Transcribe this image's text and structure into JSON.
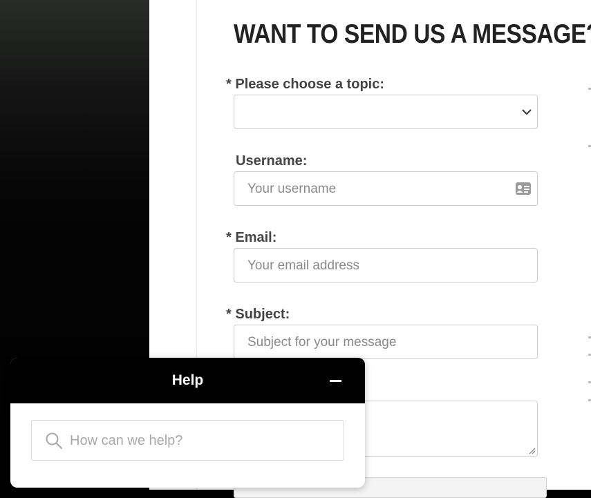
{
  "form": {
    "title": "WANT TO SEND US A MESSAGE?",
    "topic": {
      "required_mark": "*",
      "label": "Please choose a topic:",
      "value": ""
    },
    "username": {
      "label": "Username:",
      "placeholder": "Your username"
    },
    "email": {
      "required_mark": "*",
      "label": "Email:",
      "placeholder": "Your email address"
    },
    "subject": {
      "required_mark": "*",
      "label": "Subject:",
      "placeholder": "Subject for your message"
    },
    "message": {
      "placeholder": ""
    }
  },
  "help_widget": {
    "title": "Help",
    "search_placeholder": "How can we help?"
  },
  "icons": {
    "topic_dropdown": "chevron-down-icon",
    "username_field": "contact-card-icon",
    "minimize": "minimize-icon",
    "help_search": "search-icon"
  },
  "colors": {
    "header_bg": "#000000",
    "title_text": "#222222",
    "label_text": "#444444",
    "placeholder": "#8a8a8a",
    "field_border": "#cccccc"
  }
}
